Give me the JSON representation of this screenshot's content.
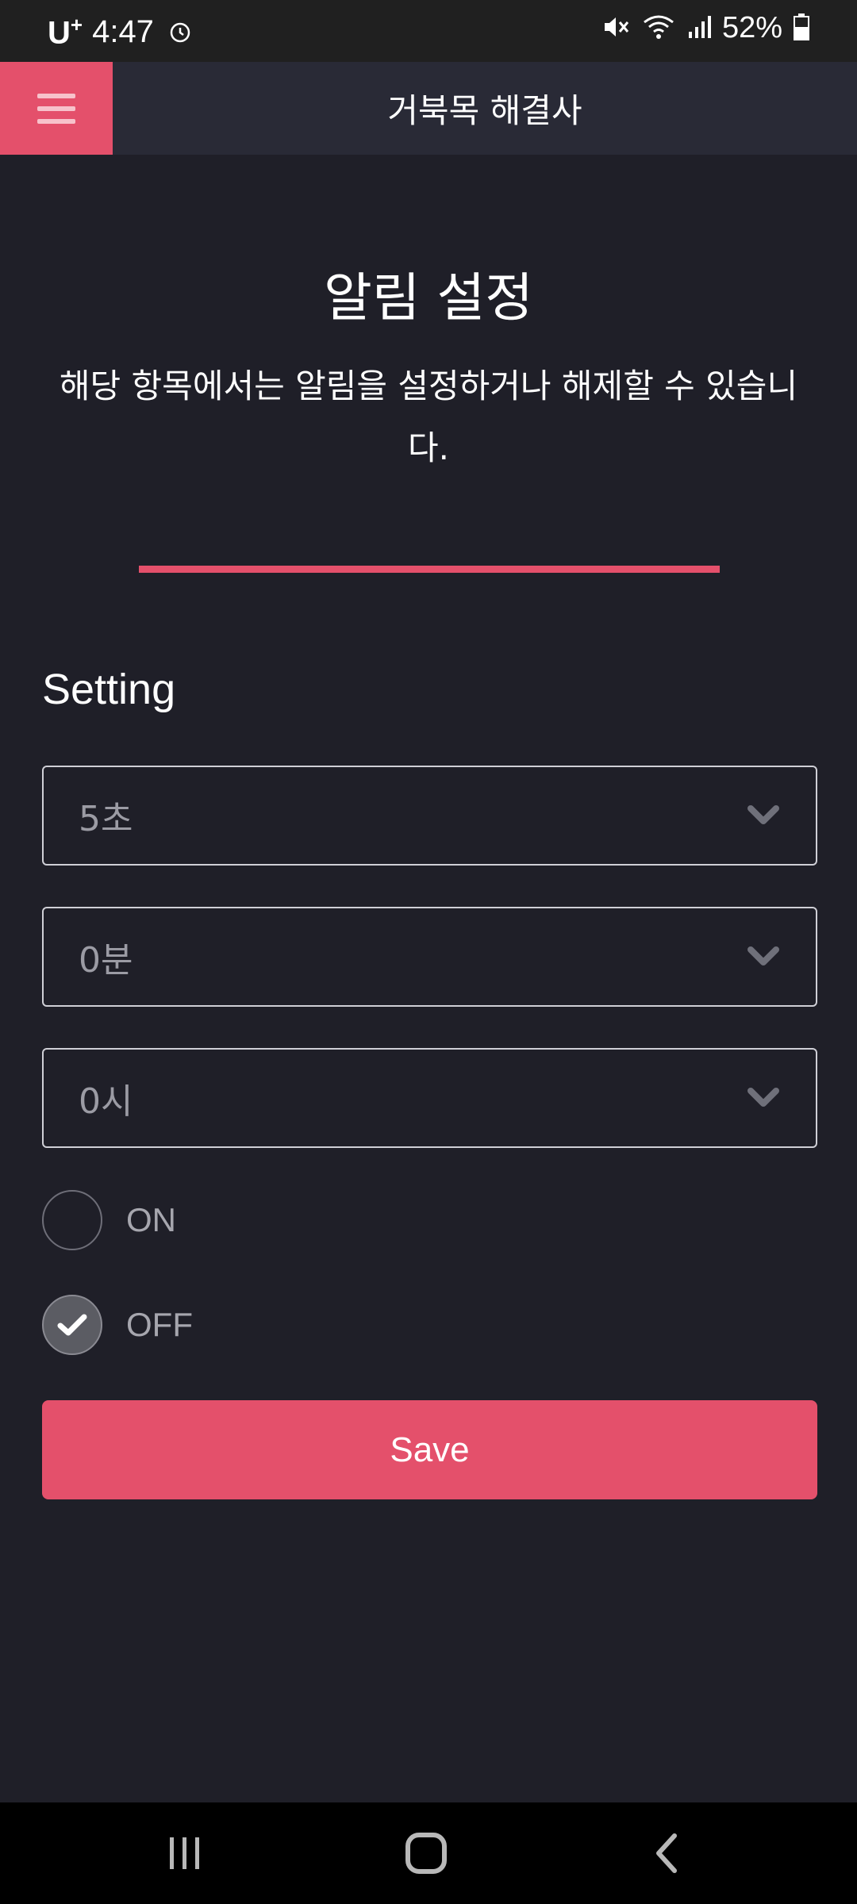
{
  "status_bar": {
    "carrier": "U",
    "carrier_sup": "+",
    "time": "4:47",
    "battery": "52%"
  },
  "header": {
    "title": "거북목 해결사"
  },
  "content": {
    "title": "알림 설정",
    "description": "해당 항목에서는 알림을 설정하거나 해제할 수 있습니다.",
    "section_label": "Setting",
    "selects": [
      {
        "value": "5초"
      },
      {
        "value": "0분"
      },
      {
        "value": "0시"
      }
    ],
    "radios": [
      {
        "label": "ON",
        "checked": false
      },
      {
        "label": "OFF",
        "checked": true
      }
    ],
    "save_label": "Save"
  },
  "colors": {
    "accent": "#e4506b",
    "background": "#1f1f28",
    "header": "#292a36"
  }
}
